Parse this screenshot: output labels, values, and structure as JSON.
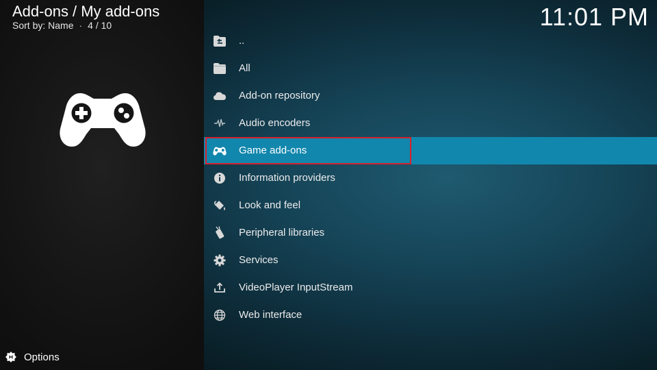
{
  "header": {
    "title": "Add-ons / My add-ons",
    "sort_label": "Sort by: Name",
    "position": "4 / 10"
  },
  "clock": "11:01 PM",
  "preview": {
    "icon": "gamepad-icon"
  },
  "footer": {
    "options_label": "Options",
    "options_icon": "options-icon"
  },
  "list": {
    "selected_index": 4,
    "items": [
      {
        "label": "..",
        "icon": "back-folder-icon"
      },
      {
        "label": "All",
        "icon": "folder-icon"
      },
      {
        "label": "Add-on repository",
        "icon": "cloud-icon"
      },
      {
        "label": "Audio encoders",
        "icon": "waveform-icon"
      },
      {
        "label": "Game add-ons",
        "icon": "gamepad-icon"
      },
      {
        "label": "Information providers",
        "icon": "info-icon"
      },
      {
        "label": "Look and feel",
        "icon": "paint-bucket-icon"
      },
      {
        "label": "Peripheral libraries",
        "icon": "peripheral-icon"
      },
      {
        "label": "Services",
        "icon": "gear-icon"
      },
      {
        "label": "VideoPlayer InputStream",
        "icon": "upload-icon"
      },
      {
        "label": "Web interface",
        "icon": "globe-icon"
      }
    ]
  },
  "colors": {
    "selection": "#1287ad",
    "highlight_border": "#d8202b"
  }
}
